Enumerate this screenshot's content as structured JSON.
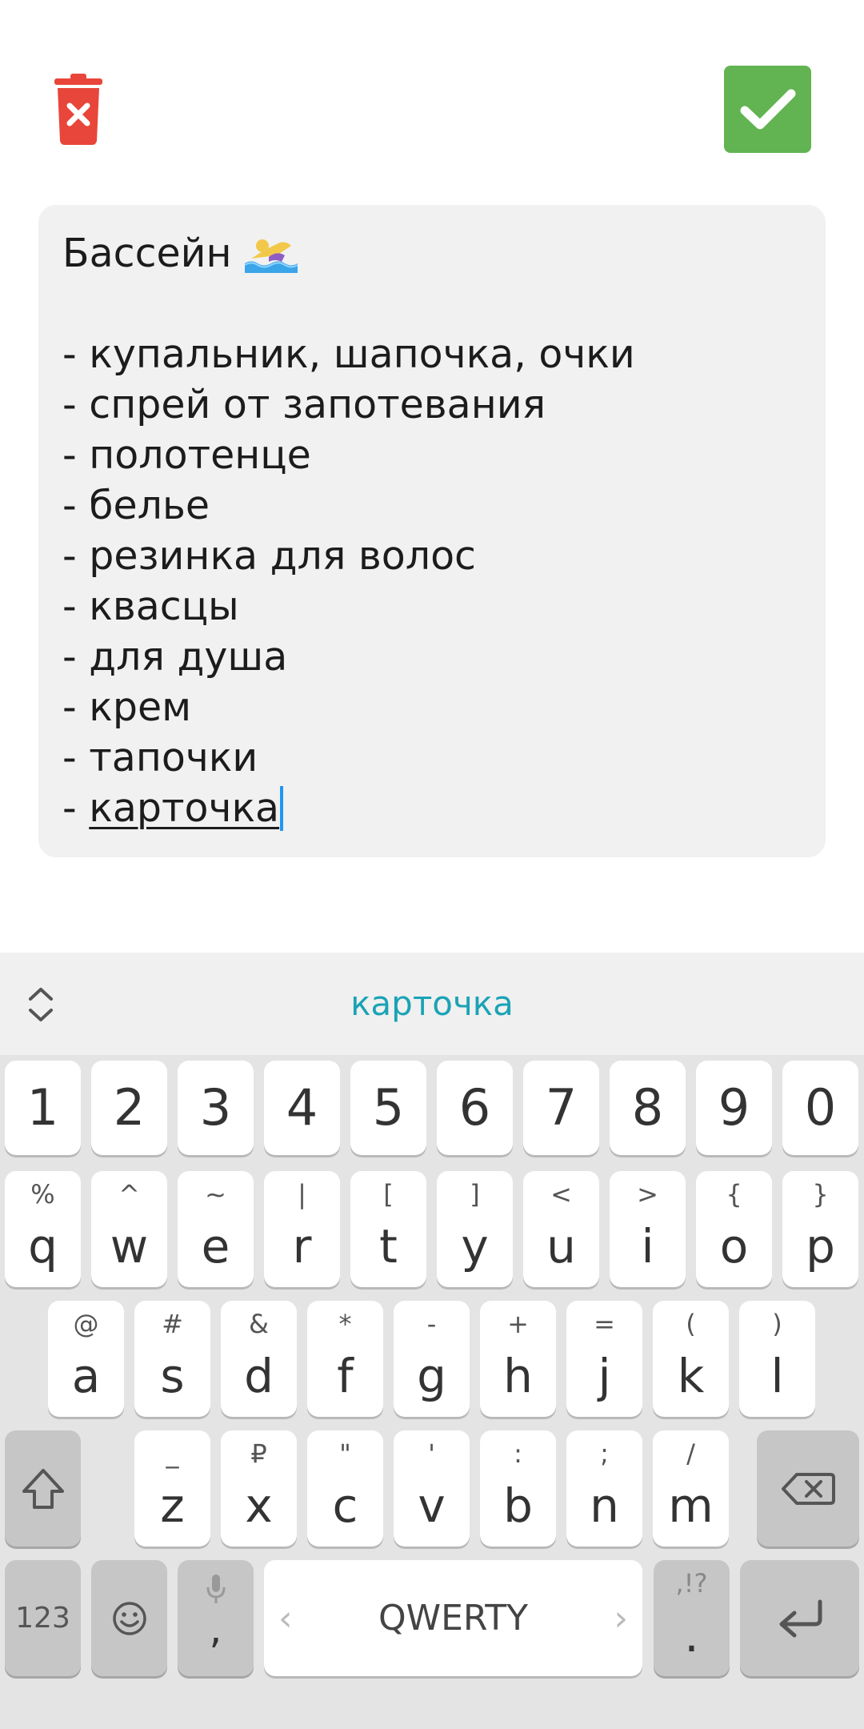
{
  "note": {
    "title": "Бассейн",
    "lines": [
      "- купальник, шапочка, очки",
      "- спрей от запотевания",
      "- полотенце",
      "- белье",
      "- резинка для волос",
      "- квасцы",
      "- для душа",
      "- крем",
      "- тапочки"
    ],
    "last_line_prefix": "- ",
    "last_line_word": "карточка"
  },
  "icons": {
    "delete": "trash-icon",
    "confirm": "checkmark-icon",
    "title_emoji": "swimmer-icon"
  },
  "colors": {
    "delete_red": "#e8463a",
    "confirm_green": "#62b351",
    "suggestion_teal": "#1aa3b5",
    "cursor_blue": "#2196f3"
  },
  "keyboard": {
    "suggestion": "карточка",
    "row_digits": [
      "1",
      "2",
      "3",
      "4",
      "5",
      "6",
      "7",
      "8",
      "9",
      "0"
    ],
    "row1": [
      {
        "main": "q",
        "hint": "%"
      },
      {
        "main": "w",
        "hint": "^"
      },
      {
        "main": "e",
        "hint": "~"
      },
      {
        "main": "r",
        "hint": "|"
      },
      {
        "main": "t",
        "hint": "["
      },
      {
        "main": "y",
        "hint": "]"
      },
      {
        "main": "u",
        "hint": "<"
      },
      {
        "main": "i",
        "hint": ">"
      },
      {
        "main": "o",
        "hint": "{"
      },
      {
        "main": "p",
        "hint": "}"
      }
    ],
    "row2": [
      {
        "main": "a",
        "hint": "@"
      },
      {
        "main": "s",
        "hint": "#"
      },
      {
        "main": "d",
        "hint": "&"
      },
      {
        "main": "f",
        "hint": "*"
      },
      {
        "main": "g",
        "hint": "-"
      },
      {
        "main": "h",
        "hint": "+"
      },
      {
        "main": "j",
        "hint": "="
      },
      {
        "main": "k",
        "hint": "("
      },
      {
        "main": "l",
        "hint": ")"
      }
    ],
    "row3": [
      {
        "main": "z",
        "hint": "_"
      },
      {
        "main": "x",
        "hint": "₽"
      },
      {
        "main": "c",
        "hint": "\""
      },
      {
        "main": "v",
        "hint": "'"
      },
      {
        "main": "b",
        "hint": ":"
      },
      {
        "main": "n",
        "hint": ";"
      },
      {
        "main": "m",
        "hint": "/"
      }
    ],
    "bottom": {
      "numbers_label": "123",
      "comma_label": ",",
      "space_label": "QWERTY",
      "period_label": ".",
      "period_hint": ",!?",
      "lang_left": "‹",
      "lang_right": "›"
    }
  }
}
